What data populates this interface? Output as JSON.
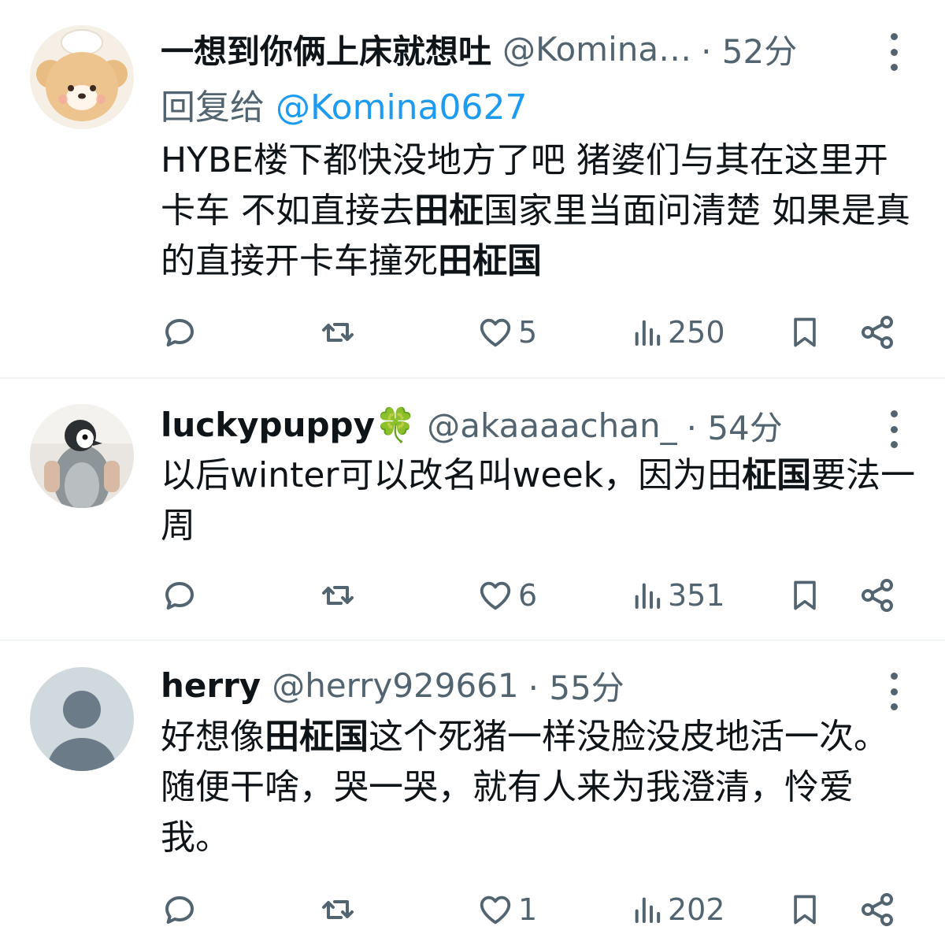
{
  "tweets": [
    {
      "name": "一想到你俩上床就想吐",
      "handle": "@Komina…",
      "time": "· 52分",
      "reply_label": "回复给",
      "reply_handle": "@Komina0627",
      "text_parts": [
        "HYBE楼下都快没地方了吧 猪婆们与其在这里开卡车 不如直接去",
        "田柾",
        "国家里当面问清楚 如果是真的直接开卡车撞死",
        "田柾国"
      ],
      "likes": "5",
      "views": "250",
      "avatar_icon": "bear-chef-avatar-icon"
    },
    {
      "name": "luckypuppy🍀",
      "handle": "@akaaaachan_",
      "time": "· 54分",
      "text_parts": [
        "以后winter可以改名叫week，因为田",
        "柾国",
        "要法一周"
      ],
      "likes": "6",
      "views": "351",
      "avatar_icon": "penguin-avatar-icon"
    },
    {
      "name": "herry",
      "handle": "@herry929661",
      "time": "· 55分",
      "text_parts": [
        "好想像",
        "田柾国",
        "这个死猪一样没脸没皮地活一次。随便干啥，哭一哭，就有人来为我澄清，怜爱我。"
      ],
      "likes": "1",
      "views": "202",
      "avatar_icon": "default-person-avatar-icon"
    }
  ],
  "colors": {
    "text": "#0f1419",
    "secondary": "#536471",
    "link": "#1d9bf0",
    "divider": "#eff3f4"
  },
  "icons": [
    "reply-icon",
    "retweet-icon",
    "heart-icon",
    "views-icon",
    "bookmark-icon",
    "share-icon",
    "more-icon"
  ]
}
